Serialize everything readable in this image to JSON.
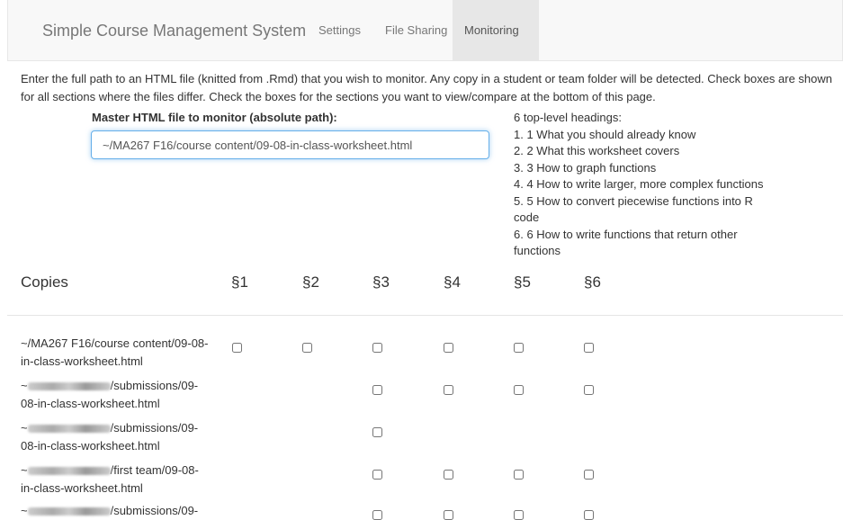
{
  "navbar": {
    "brand": "Simple Course Management System",
    "items": [
      {
        "label": "Settings",
        "active": false
      },
      {
        "label": "File Sharing",
        "active": false
      },
      {
        "label": "Monitoring",
        "active": true
      }
    ]
  },
  "intro": "Enter the full path to an HTML file (knitted from .Rmd) that you wish to monitor. Any copy in a student or team folder will be detected. Check boxes are shown for all sections where the files differ. Check the boxes for the sections you want to view/compare at the bottom of this page.",
  "master": {
    "label": "Master HTML file to monitor (absolute path):",
    "value": "~/MA267 F16/course content/09-08-in-class-worksheet.html"
  },
  "headings": {
    "summary": "6 top-level headings:",
    "items": [
      "1. 1 What you should already know",
      "2. 2 What this worksheet covers",
      "3. 3 How to graph functions",
      "4. 4 How to write larger, more complex functions",
      "5. 5 How to convert piecewise functions into R code",
      "6. 6 How to write functions that return other functions"
    ]
  },
  "table": {
    "copies_header": "Copies",
    "sections": [
      "§1",
      "§2",
      "§3",
      "§4",
      "§5",
      "§6"
    ],
    "rows": [
      {
        "prefix": "~/MA267 F16/course content/09-08-in-class-worksheet.html",
        "redacted": false,
        "suffix": "",
        "checks": [
          true,
          true,
          true,
          true,
          true,
          true
        ]
      },
      {
        "prefix": "~",
        "redacted": true,
        "suffix": "/submissions/09-08-in-class-worksheet.html",
        "checks": [
          false,
          false,
          true,
          true,
          true,
          true
        ]
      },
      {
        "prefix": "~",
        "redacted": true,
        "suffix": "/submissions/09-08-in-class-worksheet.html",
        "checks": [
          false,
          false,
          true,
          false,
          false,
          false
        ]
      },
      {
        "prefix": "~",
        "redacted": true,
        "suffix": "/first team/09-08-in-class-worksheet.html",
        "checks": [
          false,
          false,
          true,
          true,
          true,
          true
        ]
      },
      {
        "prefix": "~",
        "redacted": true,
        "suffix": "/submissions/09-",
        "checks": [
          false,
          false,
          true,
          true,
          true,
          true
        ]
      }
    ]
  }
}
